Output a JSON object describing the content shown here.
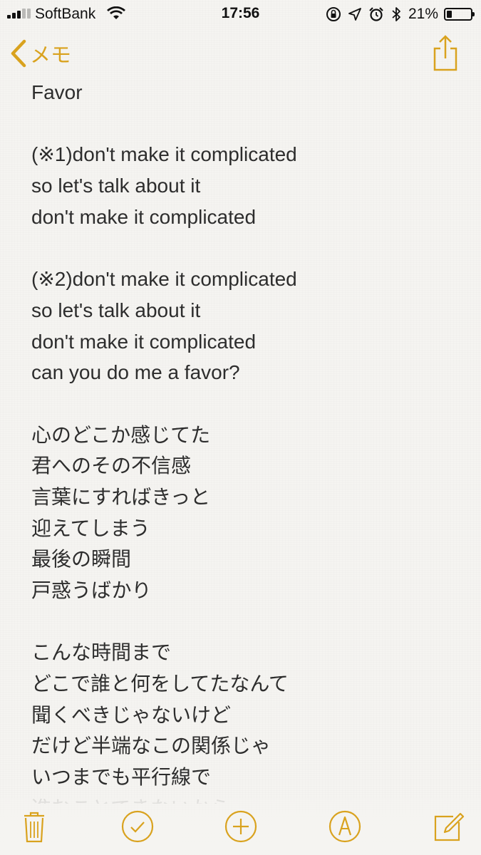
{
  "status_bar": {
    "carrier": "SoftBank",
    "time": "17:56",
    "battery_percent": "21%",
    "battery_level": 0.21,
    "icons": [
      "signal-icon",
      "wifi-icon",
      "rotation-lock-icon",
      "location-icon",
      "alarm-icon",
      "bluetooth-icon",
      "battery-icon"
    ]
  },
  "nav": {
    "back_label": "メモ",
    "share_icon": "share-icon"
  },
  "note": {
    "lines": [
      "Favor",
      "",
      "(※1)don't make it complicated",
      "so let's talk about it",
      "don't make it complicated",
      "",
      "(※2)don't make it complicated",
      "so let's talk about it",
      "don't make it complicated",
      "can you do me a favor?",
      "",
      "心のどこか感じてた",
      "君へのその不信感",
      "言葉にすればきっと",
      "迎えてしまう",
      "最後の瞬間",
      "戸惑うばかり",
      "",
      "こんな時間まで",
      "どこで誰と何をしてたなんて",
      "聞くべきじゃないけど",
      "だけど半端なこの関係じゃ",
      "いつまでも平行線で",
      "進むことできないから"
    ]
  },
  "toolbar": {
    "icons": [
      "trash-icon",
      "checklist-icon",
      "add-icon",
      "markup-icon",
      "compose-icon"
    ]
  },
  "colors": {
    "accent": "#d9a21e",
    "text": "#2d2d2d",
    "background": "#f5f4f1"
  }
}
